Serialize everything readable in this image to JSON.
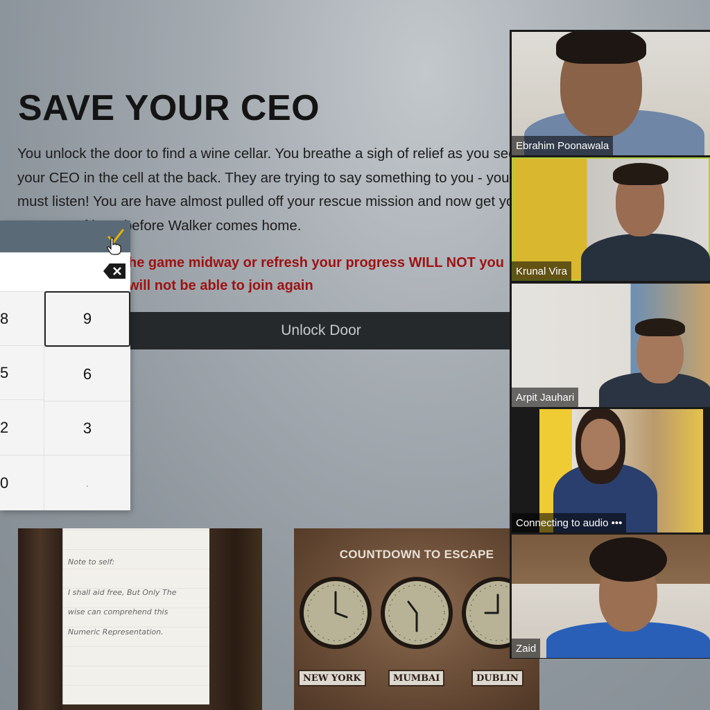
{
  "game": {
    "title": "SAVE YOUR CEO",
    "story": "You unlock the door to find a wine cellar. You breathe a sigh of relief as you see your CEO in the cell at the back. They are trying to say something to you - you must listen! You are have almost pulled off your rescue mission and now get your CEO out of here before Walker comes home.",
    "warning": "he game midway or refresh your progress WILL NOT you will not be able to join again",
    "unlock_button": "Unlock Door"
  },
  "keypad": {
    "keys": [
      {
        "label": "8",
        "partial": true
      },
      {
        "label": "9",
        "selected": true
      },
      {
        "label": "5",
        "partial": true
      },
      {
        "label": "6"
      },
      {
        "label": "2",
        "partial": true
      },
      {
        "label": "3"
      },
      {
        "label": "0",
        "partial": true
      },
      {
        "label": "."
      }
    ]
  },
  "cards": {
    "note": {
      "lines": [
        "Note to self:",
        "I shall aid free, But Only The",
        "wise can comprehend this",
        "Numeric Representation."
      ]
    },
    "countdown": {
      "title": "COUNTDOWN TO ESCAPE",
      "cities": [
        "NEW YORK",
        "MUMBAI",
        "DUBLIN"
      ]
    }
  },
  "participants": [
    {
      "name": "Ebrahim Poonawala",
      "active": false
    },
    {
      "name": "Krunal Vira",
      "active": true
    },
    {
      "name": "Arpit Jauhari",
      "active": false
    },
    {
      "name": "Connecting to audio •••",
      "active": false
    },
    {
      "name": "Zaid",
      "active": false
    }
  ],
  "colors": {
    "accent_border": "#b4cf3a",
    "warning_text": "#9e1212",
    "keypad_header": "#5a6a76",
    "unlock_bar": "#25292c"
  },
  "icons": [
    "check-icon",
    "backspace-icon",
    "hand-cursor-icon",
    "clock-icon"
  ]
}
